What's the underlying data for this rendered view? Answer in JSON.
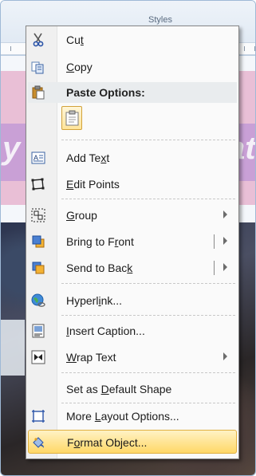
{
  "background": {
    "ribbon_label": "Styles",
    "pink_text_left": "y",
    "pink_text_right": "ate"
  },
  "menu": {
    "items": {
      "cut": {
        "pre": "Cu",
        "key": "t",
        "post": ""
      },
      "copy": {
        "pre": "",
        "key": "C",
        "post": "opy"
      },
      "paste_options": {
        "label": "Paste Options:"
      },
      "add_text": {
        "pre": "Add Te",
        "key": "x",
        "post": "t"
      },
      "edit_points": {
        "pre": "",
        "key": "E",
        "post": "dit Points"
      },
      "group": {
        "pre": "",
        "key": "G",
        "post": "roup"
      },
      "bring_to_front": {
        "pre": "Bring to F",
        "key": "r",
        "post": "ont"
      },
      "send_to_back": {
        "pre": "Send to Bac",
        "key": "k",
        "post": ""
      },
      "hyperlink": {
        "pre": "Hyperl",
        "key": "i",
        "post": "nk..."
      },
      "insert_caption": {
        "pre": "",
        "key": "I",
        "post": "nsert Caption..."
      },
      "wrap_text": {
        "pre": "",
        "key": "W",
        "post": "rap Text"
      },
      "set_default_shape": {
        "pre": "Set as ",
        "key": "D",
        "post": "efault Shape"
      },
      "more_layout": {
        "pre": "More ",
        "key": "L",
        "post": "ayout Options..."
      },
      "format_object": {
        "pre": "F",
        "key": "o",
        "post": "rmat Object..."
      }
    }
  },
  "colors": {
    "highlight_top": "#fff2c5",
    "highlight_bottom": "#ffd867",
    "pink_band": "#e9bfd6",
    "purple_strip": "#c9a0d6"
  },
  "icons": {
    "cut": "scissors-icon",
    "copy": "copy-icon",
    "paste_options": "paste-icon",
    "add_text": "text-box-icon",
    "edit_points": "edit-points-icon",
    "group": "group-icon",
    "bring_to_front": "bring-forward-icon",
    "send_to_back": "send-backward-icon",
    "hyperlink": "hyperlink-globe-icon",
    "insert_caption": "caption-icon",
    "wrap_text": "wrap-text-icon",
    "more_layout": "layout-options-icon",
    "format_object": "format-object-icon"
  }
}
